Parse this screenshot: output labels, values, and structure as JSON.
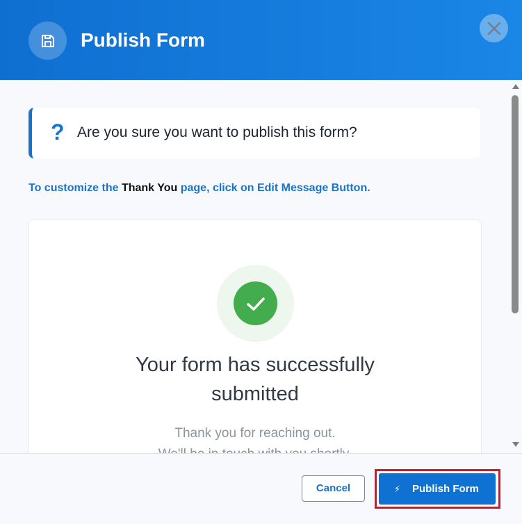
{
  "header": {
    "title": "Publish Form",
    "icon": "save-icon",
    "close_icon": "close-icon"
  },
  "confirm": {
    "icon": "question-icon",
    "question_mark": "?",
    "text": "Are you sure you want to publish this form?"
  },
  "hint": {
    "prefix": "To customize the",
    "emphasis": "Thank You",
    "suffix": "page, click on Edit Message Button."
  },
  "preview": {
    "icon": "check-icon",
    "title_line1": "Your form has successfully",
    "title_line2": "submitted",
    "message_line1": "Thank you for reaching out.",
    "message_line2": "We'll be in touch with you shortly."
  },
  "footer": {
    "cancel_label": "Cancel",
    "publish_label": "Publish Form",
    "publish_icon": "lightning-icon"
  },
  "colors": {
    "header": "#1a86e6",
    "accent": "#1a73c9",
    "success": "#43ad4e",
    "highlight": "#e0121b"
  }
}
